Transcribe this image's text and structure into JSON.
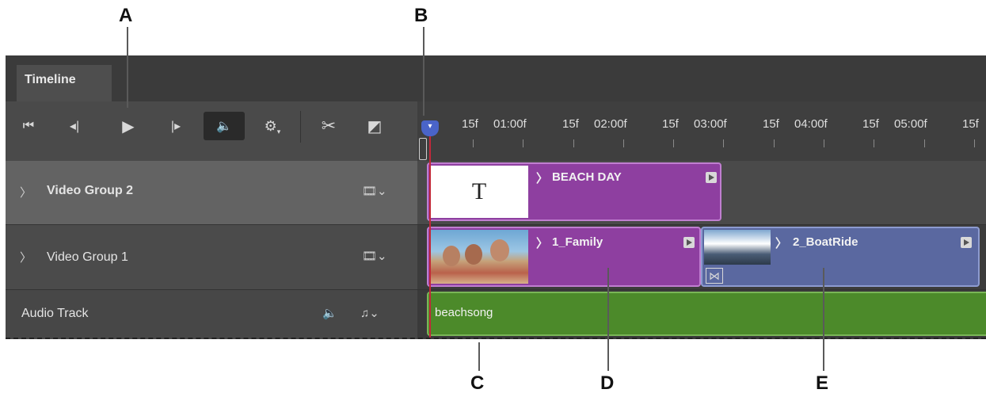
{
  "callouts": {
    "a": "A",
    "b": "B",
    "c": "C",
    "d": "D",
    "e": "E"
  },
  "panel": {
    "tab_label": "Timeline"
  },
  "toolbar": {
    "go_first": "⏮",
    "step_back": "◂|",
    "play": "▶",
    "step_forward": "|▸",
    "mute_audio": "🔈",
    "settings": "⚙",
    "split": "✂",
    "transition": "◩"
  },
  "ruler": {
    "labels": [
      "15f",
      "01:00f",
      "15f",
      "02:00f",
      "15f",
      "03:00f",
      "15f",
      "04:00f",
      "15f",
      "05:00f",
      "15f"
    ]
  },
  "tracks": {
    "video_group_2": {
      "label": "Video Group 2"
    },
    "video_group_1": {
      "label": "Video Group 1"
    },
    "audio_track": {
      "label": "Audio Track"
    }
  },
  "clips": {
    "beach_day": {
      "name": "BEACH DAY",
      "thumb_letter": "T"
    },
    "family": {
      "name": "1_Family"
    },
    "boat_ride": {
      "name": "2_BoatRide"
    },
    "beachsong": {
      "name": "beachsong"
    }
  },
  "colors": {
    "video_clip": "#8e3fa0",
    "boat_clip": "#5a68a0",
    "audio_clip": "#4c8a2a",
    "playhead": "#4a64c8"
  }
}
